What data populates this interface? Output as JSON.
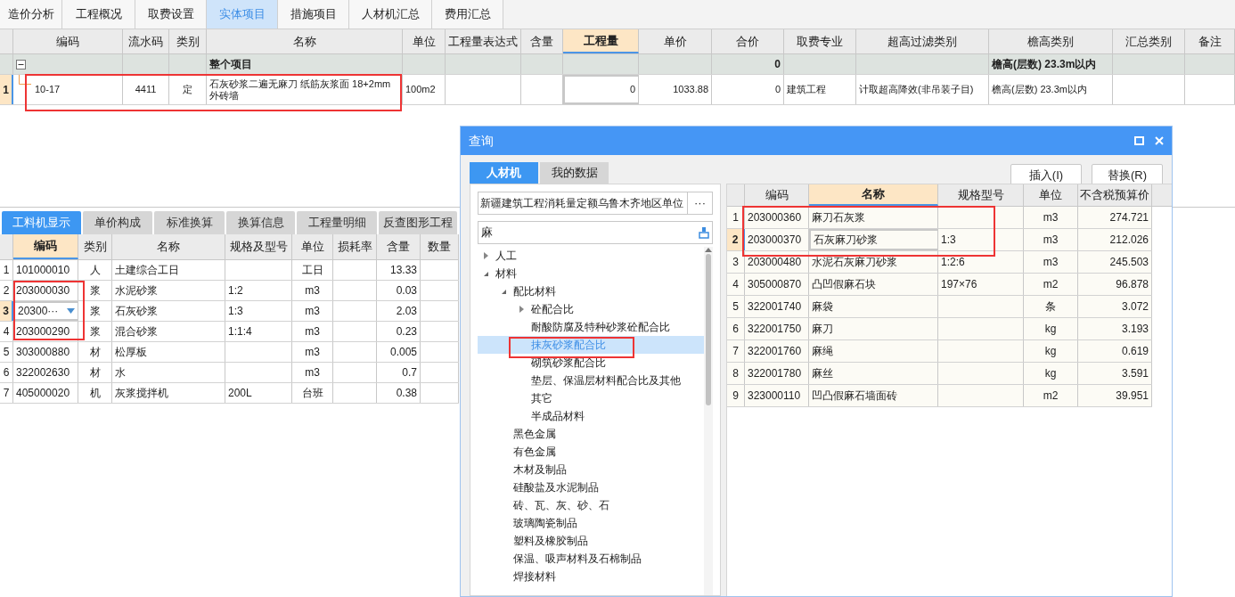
{
  "tabs": [
    {
      "label": "造价分析",
      "selected": false
    },
    {
      "label": "工程概况",
      "selected": false
    },
    {
      "label": "取费设置",
      "selected": false
    },
    {
      "label": "实体项目",
      "selected": true
    },
    {
      "label": "措施项目",
      "selected": false
    },
    {
      "label": "人材机汇总",
      "selected": false
    },
    {
      "label": "费用汇总",
      "selected": false
    }
  ],
  "main_table": {
    "columns": [
      {
        "label": "编码",
        "selected": false
      },
      {
        "label": "流水码",
        "selected": false
      },
      {
        "label": "类别",
        "selected": false
      },
      {
        "label": "名称",
        "selected": false
      },
      {
        "label": "单位",
        "selected": false
      },
      {
        "label": "工程量表达式",
        "selected": false
      },
      {
        "label": "含量",
        "selected": false
      },
      {
        "label": "工程量",
        "selected": true
      },
      {
        "label": "单价",
        "selected": false
      },
      {
        "label": "合价",
        "selected": false
      },
      {
        "label": "取费专业",
        "selected": false
      },
      {
        "label": "超高过滤类别",
        "selected": false
      },
      {
        "label": "檐高类别",
        "selected": false
      },
      {
        "label": "汇总类别",
        "selected": false
      },
      {
        "label": "备注",
        "selected": false
      }
    ],
    "rows": [
      {
        "kind": "group",
        "expanded": true,
        "selected": false,
        "cells": [
          "",
          "",
          "",
          "整个项目",
          "",
          "",
          "",
          "",
          "",
          "0",
          "",
          "",
          "檐高(层数) 23.3m以内",
          "",
          ""
        ]
      },
      {
        "kind": "item",
        "number": "1",
        "selected": true,
        "cells": [
          "10-17",
          "4411",
          "定",
          "石灰砂浆二遍无麻刀 纸筋灰浆面 18+2mm\n外砖墙",
          "100m2",
          "",
          "",
          "0",
          "1033.88",
          "0",
          "建筑工程",
          "计取超高降效(非吊装子目)",
          "檐高(层数) 23.3m以内",
          "",
          ""
        ]
      }
    ]
  },
  "detail_tabs": [
    {
      "label": "工料机显示",
      "selected": true
    },
    {
      "label": "单价构成",
      "selected": false
    },
    {
      "label": "标准换算",
      "selected": false
    },
    {
      "label": "换算信息",
      "selected": false
    },
    {
      "label": "工程量明细",
      "selected": false
    },
    {
      "label": "反查图形工程",
      "selected": false
    }
  ],
  "detail_table": {
    "columns": [
      {
        "label": "编码",
        "selected": true
      },
      {
        "label": "类别",
        "selected": false
      },
      {
        "label": "名称",
        "selected": false
      },
      {
        "label": "规格及型号",
        "selected": false
      },
      {
        "label": "单位",
        "selected": false
      },
      {
        "label": "损耗率",
        "selected": false
      },
      {
        "label": "含量",
        "selected": false
      },
      {
        "label": "数量",
        "selected": false
      }
    ],
    "rows": [
      {
        "number": "1",
        "selected": false,
        "dropdown": false,
        "cells": [
          "101000010",
          "人",
          "土建综合工日",
          "",
          "工日",
          "",
          "13.33",
          ""
        ]
      },
      {
        "number": "2",
        "selected": false,
        "dropdown": false,
        "cells": [
          "203000030",
          "浆",
          "水泥砂浆",
          "1:2",
          "m3",
          "",
          "0.03",
          ""
        ]
      },
      {
        "number": "3",
        "selected": true,
        "dropdown": true,
        "cells": [
          "20300···",
          "浆",
          "石灰砂浆",
          "1:3",
          "m3",
          "",
          "2.03",
          ""
        ]
      },
      {
        "number": "4",
        "selected": false,
        "dropdown": false,
        "cells": [
          "203000290",
          "浆",
          "混合砂浆",
          "1:1:4",
          "m3",
          "",
          "0.23",
          ""
        ]
      },
      {
        "number": "5",
        "selected": false,
        "dropdown": false,
        "cells": [
          "303000880",
          "材",
          "松厚板",
          "",
          "m3",
          "",
          "0.005",
          ""
        ]
      },
      {
        "number": "6",
        "selected": false,
        "dropdown": false,
        "cells": [
          "322002630",
          "材",
          "水",
          "",
          "m3",
          "",
          "0.7",
          ""
        ]
      },
      {
        "number": "7",
        "selected": false,
        "dropdown": false,
        "cells": [
          "405000020",
          "机",
          "灰浆搅拌机",
          "200L",
          "台班",
          "",
          "0.38",
          ""
        ]
      }
    ]
  },
  "dialog": {
    "title": "查询",
    "tabs": [
      {
        "label": "人材机",
        "selected": true
      },
      {
        "label": "我的数据",
        "selected": false
      }
    ],
    "buttons": [
      "插入(I)",
      "替换(R)"
    ],
    "library": {
      "value": "新疆建筑工程消耗量定额乌鲁木齐地区单位",
      "button": "···"
    },
    "search": {
      "value": "麻"
    },
    "tree": [
      {
        "label": "人工",
        "expanded": false,
        "selected": false
      },
      {
        "label": "材料",
        "expanded": true,
        "selected": false,
        "children": [
          {
            "label": "配比材料",
            "expanded": true,
            "selected": false,
            "children": [
              {
                "label": "砼配合比",
                "expanded": false,
                "selected": false
              },
              {
                "label": "耐酸防腐及特种砂浆砼配合比",
                "selected": false
              },
              {
                "label": "抹灰砂浆配合比",
                "selected": true
              },
              {
                "label": "砌筑砂浆配合比",
                "selected": false
              },
              {
                "label": "垫层、保温层材料配合比及其他",
                "selected": false
              },
              {
                "label": "其它",
                "selected": false
              },
              {
                "label": "半成品材料",
                "selected": false
              }
            ]
          },
          {
            "label": "黑色金属",
            "selected": false
          },
          {
            "label": "有色金属",
            "selected": false
          },
          {
            "label": "木材及制品",
            "selected": false
          },
          {
            "label": "硅酸盐及水泥制品",
            "selected": false
          },
          {
            "label": "砖、瓦、灰、砂、石",
            "selected": false
          },
          {
            "label": "玻璃陶瓷制品",
            "selected": false
          },
          {
            "label": "塑料及橡胶制品",
            "selected": false
          },
          {
            "label": "保温、吸声材料及石棉制品",
            "selected": false
          },
          {
            "label": "焊接材料",
            "selected": false
          }
        ]
      }
    ],
    "table": {
      "columns": [
        {
          "label": "编码",
          "selected": false
        },
        {
          "label": "名称",
          "selected": true
        },
        {
          "label": "规格型号",
          "selected": false
        },
        {
          "label": "单位",
          "selected": false
        },
        {
          "label": "不含税预算价",
          "selected": false
        }
      ],
      "rows": [
        {
          "number": "1",
          "selected": false,
          "cells": [
            "203000360",
            "麻刀石灰浆",
            "",
            "m3",
            "274.721"
          ]
        },
        {
          "number": "2",
          "selected": true,
          "cells": [
            "203000370",
            "石灰麻刀砂浆",
            "1:3",
            "m3",
            "212.026"
          ]
        },
        {
          "number": "3",
          "selected": false,
          "cells": [
            "203000480",
            "水泥石灰麻刀砂浆",
            "1:2:6",
            "m3",
            "245.503"
          ]
        },
        {
          "number": "4",
          "selected": false,
          "cells": [
            "305000870",
            "凸凹假麻石块",
            "197×76",
            "m2",
            "96.878"
          ]
        },
        {
          "number": "5",
          "selected": false,
          "cells": [
            "322001740",
            "麻袋",
            "",
            "条",
            "3.072"
          ]
        },
        {
          "number": "6",
          "selected": false,
          "cells": [
            "322001750",
            "麻刀",
            "",
            "kg",
            "3.193"
          ]
        },
        {
          "number": "7",
          "selected": false,
          "cells": [
            "322001760",
            "麻绳",
            "",
            "kg",
            "0.619"
          ]
        },
        {
          "number": "8",
          "selected": false,
          "cells": [
            "322001780",
            "麻丝",
            "",
            "kg",
            "3.591"
          ]
        },
        {
          "number": "9",
          "selected": false,
          "cells": [
            "323000110",
            "凹凸假麻石墙面砖",
            "",
            "m2",
            "39.951"
          ]
        }
      ]
    }
  }
}
